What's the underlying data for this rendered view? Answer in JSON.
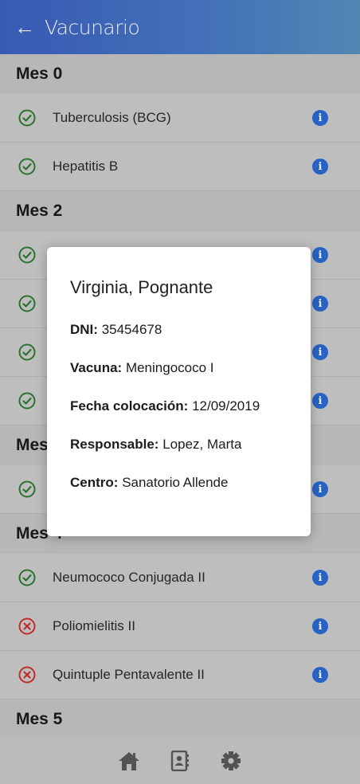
{
  "header": {
    "title": "Vacunario",
    "back_icon": "arrow-left-icon"
  },
  "colors": {
    "header_gradient_start": "#3d62c4",
    "header_gradient_end": "#5a93c2",
    "applied": "#2e7d32",
    "missing": "#d32f2f",
    "info": "#2a6cd6"
  },
  "sections": [
    {
      "title": "Mes 0",
      "items": [
        {
          "label": "Tuberculosis (BCG)",
          "status": "applied"
        },
        {
          "label": "Hepatitis B",
          "status": "applied"
        }
      ]
    },
    {
      "title": "Mes 2",
      "items": [
        {
          "label": "",
          "status": "applied"
        },
        {
          "label": "",
          "status": "applied"
        },
        {
          "label": "",
          "status": "applied"
        },
        {
          "label": "",
          "status": "applied"
        }
      ]
    },
    {
      "title": "Mes",
      "items": [
        {
          "label": "",
          "status": "applied"
        }
      ]
    },
    {
      "title": "Mes 4",
      "items": [
        {
          "label": "Neumococo Conjugada II",
          "status": "applied"
        },
        {
          "label": "Poliomielitis II",
          "status": "missing"
        },
        {
          "label": "Quintuple Pentavalente II",
          "status": "missing"
        }
      ]
    },
    {
      "title": "Mes 5",
      "items": []
    }
  ],
  "modal": {
    "name": "Virginia, Pognante",
    "fields": [
      {
        "key": "DNI:",
        "value": "35454678"
      },
      {
        "key": "Vacuna:",
        "value": "Meningococo I"
      },
      {
        "key": "Fecha colocación:",
        "value": "12/09/2019"
      },
      {
        "key": "Responsable:",
        "value": "Lopez, Marta"
      },
      {
        "key": "Centro:",
        "value": "Sanatorio Allende"
      }
    ]
  },
  "tabbar": {
    "tabs": [
      "home-icon",
      "contacts-icon",
      "settings-icon"
    ]
  }
}
